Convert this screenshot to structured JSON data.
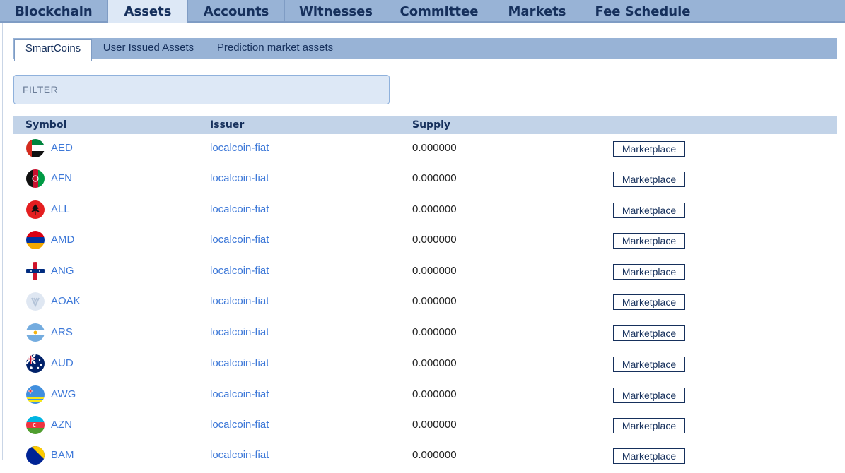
{
  "nav": {
    "tabs": [
      {
        "label": "Blockchain"
      },
      {
        "label": "Assets"
      },
      {
        "label": "Accounts"
      },
      {
        "label": "Witnesses"
      },
      {
        "label": "Committee"
      },
      {
        "label": "Markets"
      },
      {
        "label": "Fee Schedule"
      }
    ],
    "active": "Assets"
  },
  "subtabs": [
    {
      "label": "SmartCoins"
    },
    {
      "label": "User Issued Assets"
    },
    {
      "label": "Prediction market assets"
    }
  ],
  "filter": {
    "placeholder": "FILTER",
    "value": ""
  },
  "table": {
    "headers": {
      "symbol": "Symbol",
      "issuer": "Issuer",
      "supply": "Supply"
    },
    "rows": [
      {
        "symbol": "AED",
        "issuer": "localcoin-fiat",
        "supply": "0.000000",
        "action": "Marketplace",
        "icon": "uae-flag-icon"
      },
      {
        "symbol": "AFN",
        "issuer": "localcoin-fiat",
        "supply": "0.000000",
        "action": "Marketplace",
        "icon": "afghanistan-flag-icon"
      },
      {
        "symbol": "ALL",
        "issuer": "localcoin-fiat",
        "supply": "0.000000",
        "action": "Marketplace",
        "icon": "albania-flag-icon"
      },
      {
        "symbol": "AMD",
        "issuer": "localcoin-fiat",
        "supply": "0.000000",
        "action": "Marketplace",
        "icon": "armenia-flag-icon"
      },
      {
        "symbol": "ANG",
        "issuer": "localcoin-fiat",
        "supply": "0.000000",
        "action": "Marketplace",
        "icon": "netherlands-antilles-flag-icon"
      },
      {
        "symbol": "AOAK",
        "issuer": "localcoin-fiat",
        "supply": "0.000000",
        "action": "Marketplace",
        "icon": "aoak-logo-icon"
      },
      {
        "symbol": "ARS",
        "issuer": "localcoin-fiat",
        "supply": "0.000000",
        "action": "Marketplace",
        "icon": "argentina-flag-icon"
      },
      {
        "symbol": "AUD",
        "issuer": "localcoin-fiat",
        "supply": "0.000000",
        "action": "Marketplace",
        "icon": "australia-flag-icon"
      },
      {
        "symbol": "AWG",
        "issuer": "localcoin-fiat",
        "supply": "0.000000",
        "action": "Marketplace",
        "icon": "aruba-flag-icon"
      },
      {
        "symbol": "AZN",
        "issuer": "localcoin-fiat",
        "supply": "0.000000",
        "action": "Marketplace",
        "icon": "azerbaijan-flag-icon"
      },
      {
        "symbol": "BAM",
        "issuer": "localcoin-fiat",
        "supply": "0.000000",
        "action": "Marketplace",
        "icon": "bosnia-flag-icon"
      }
    ]
  },
  "colors": {
    "nav_bg": "#98b3d6",
    "active_tab_bg": "#dde8f6",
    "link": "#3d78d8",
    "text_dark": "#16305c",
    "header_bg": "#c2d3e8"
  }
}
